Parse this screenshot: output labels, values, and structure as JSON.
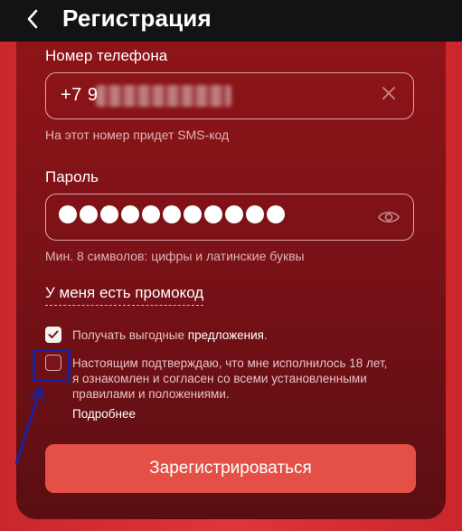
{
  "header": {
    "back_icon": "chevron-left-icon",
    "title": "Регистрация"
  },
  "phone": {
    "label": "Номер телефона",
    "prefix": "+7",
    "first_digit": "9",
    "hint": "На этот номер придет SMS-код",
    "clear_icon": "close-icon"
  },
  "password": {
    "label": "Пароль",
    "masked_length": 11,
    "hint": "Мин. 8 символов: цифры и латинские буквы",
    "visibility_icon": "eye-icon"
  },
  "promo_link": "У меня есть промокод",
  "offers": {
    "checked": true,
    "text": "Получать выгодные",
    "link": "предложения",
    "suffix": "."
  },
  "age_confirm": {
    "checked": false,
    "text_line1": "Настоящим подтверждаю, что мне исполнилось 18 лет,",
    "text_line2": "я ознакомлен и согласен со всеми установленными",
    "text_line3": "правилами и положениями.",
    "more_link": "Подробнее"
  },
  "register_button": "Зарегистрироваться",
  "colors": {
    "accent": "#e45046",
    "background_red": "#d52e33",
    "card": "#7d1217",
    "annotation": "#1b22a0"
  }
}
